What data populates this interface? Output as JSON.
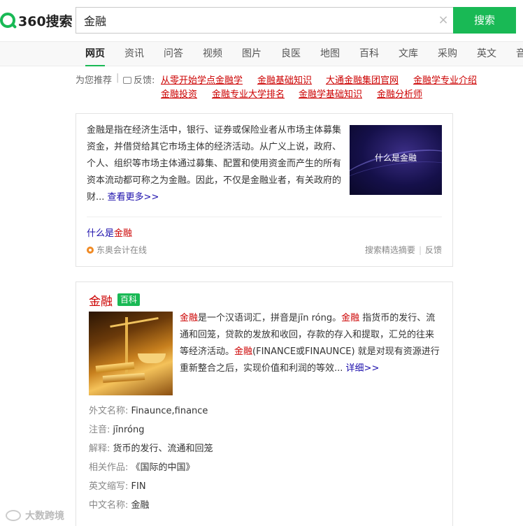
{
  "logo": {
    "text": "360搜索"
  },
  "search": {
    "query": "金融",
    "clear_glyph": "×",
    "button_label": "搜索"
  },
  "nav": {
    "items": [
      "网页",
      "资讯",
      "问答",
      "视频",
      "图片",
      "良医",
      "地图",
      "百科",
      "文库",
      "采购",
      "英文",
      "音"
    ],
    "active": "网页"
  },
  "recommend": {
    "label": "为您推荐",
    "separator": "|",
    "feedback_label": "反馈:",
    "links_row1": [
      "从零开始学点金融学",
      "金融基础知识",
      "大通金融集团官网",
      "金融学专业介绍"
    ],
    "links_row2": [
      "金融投资",
      "金融专业大学排名",
      "金融学基础知识",
      "金融分析师"
    ]
  },
  "card1": {
    "text": "金融是指在经济生活中，银行、证券或保险业者从市场主体募集资金，并借贷给其它市场主体的经济活动。从广义上说，政府、个人、组织等市场主体通过募集、配置和使用资金而产生的所有资本流动都可称之为金融。因此，不仅是金融业者，有关政府的财...",
    "more_label": "查看更多>>",
    "image_title": "什么是金融",
    "question_prefix": "什么是",
    "question_highlight": "金融",
    "source": "东奥会计在线",
    "footer_left": "搜索精选摘要",
    "footer_sep": "|",
    "footer_right": "反馈"
  },
  "card2": {
    "title": "金融",
    "badge": "百科",
    "hl1": "金融",
    "p1": "是一个汉语词汇，拼音是jīn róng。",
    "hl2": "金融",
    "p2": " 指货币的发行、流通和回笼，贷款的发放和收回，存款的存入和提取，汇兑的往来等经济活动。",
    "hl3": "金融",
    "p3": "(FINANCE或FINAUNCE) 就是对现有资源进行重新整合之后，实现价值和利润的等效...",
    "more_label": "详细>>",
    "info": [
      {
        "label": "外文名称:",
        "value": "Finaunce,finance"
      },
      {
        "label": "注音:",
        "value": "jīnróng"
      },
      {
        "label": "解释:",
        "value": "货币的发行、流通和回笼"
      },
      {
        "label": "相关作品:",
        "value": "《国际的中国》"
      },
      {
        "label": "英文缩写:",
        "value": "FIN"
      },
      {
        "label": "中文名称:",
        "value": "金融"
      }
    ]
  },
  "watermark": {
    "text": "大数跨境"
  },
  "colors": {
    "brand_green": "#19b955",
    "link_red": "#c00000",
    "link_blue": "#1a0dab"
  }
}
